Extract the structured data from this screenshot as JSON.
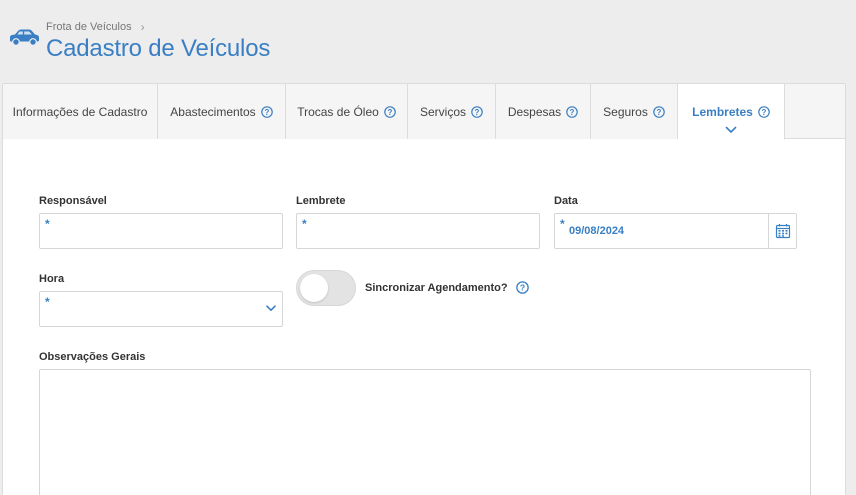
{
  "header": {
    "breadcrumb": "Frota de Veículos",
    "title": "Cadastro de Veículos"
  },
  "tabs": [
    {
      "label": "Informações de Cadastro",
      "help": false
    },
    {
      "label": "Abastecimentos",
      "help": true
    },
    {
      "label": "Trocas de Óleo",
      "help": true
    },
    {
      "label": "Serviços",
      "help": true
    },
    {
      "label": "Despesas",
      "help": true
    },
    {
      "label": "Seguros",
      "help": true
    },
    {
      "label": "Lembretes",
      "help": true,
      "active": true
    }
  ],
  "form": {
    "responsavel": {
      "label": "Responsável",
      "required_mark": "*",
      "value": ""
    },
    "lembrete": {
      "label": "Lembrete",
      "required_mark": "*",
      "value": ""
    },
    "data": {
      "label": "Data",
      "required_mark": "*",
      "value": "09/08/2024"
    },
    "hora": {
      "label": "Hora",
      "required_mark": "*",
      "value": ""
    },
    "sincronizar": {
      "label": "Sincronizar Agendamento?",
      "enabled": false
    },
    "observacoes": {
      "label": "Observações Gerais",
      "value": ""
    }
  },
  "colors": {
    "accent": "#3a7fc4",
    "background": "#ededed"
  }
}
